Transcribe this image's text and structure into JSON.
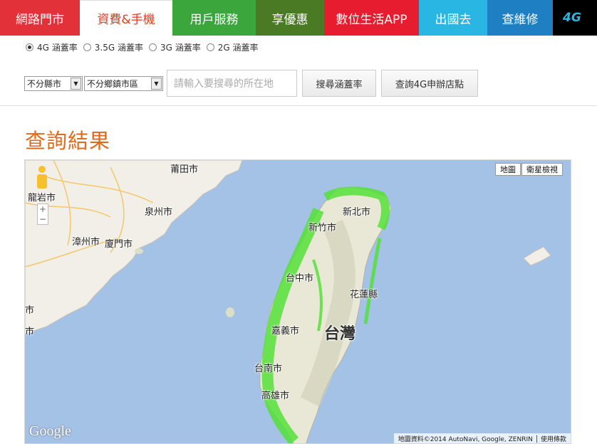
{
  "nav": {
    "items": [
      {
        "label": "網路門市",
        "color": "#e23138"
      },
      {
        "label": "資費&手機",
        "color": "#ffffff",
        "active": true
      },
      {
        "label": "用戶服務",
        "color": "#3aa63c"
      },
      {
        "label": "享優惠",
        "color": "#4b7a24"
      },
      {
        "label": "數位生活APP",
        "color": "#e71c2f"
      },
      {
        "label": "出國去",
        "color": "#2ab6e3"
      },
      {
        "label": "查維修",
        "color": "#1e7fc2"
      },
      {
        "label": "4G",
        "color": "#000000"
      }
    ]
  },
  "coverage": {
    "options": [
      {
        "label": "4G 涵蓋率",
        "selected": true
      },
      {
        "label": "3.5G 涵蓋率",
        "selected": false
      },
      {
        "label": "3G 涵蓋率",
        "selected": false
      },
      {
        "label": "2G 涵蓋率",
        "selected": false
      }
    ]
  },
  "search": {
    "county_select": "不分縣市",
    "district_select": "不分鄉鎮市區",
    "placeholder": "請輸入要搜尋的所在地",
    "search_button": "搜尋涵蓋率",
    "store_button": "查詢4G申辦店點"
  },
  "results": {
    "title": "查詢結果"
  },
  "map": {
    "type_map": "地圖",
    "type_satellite": "衛星檢視",
    "zoom_in": "+",
    "zoom_out": "−",
    "logo": "Google",
    "attribution": "地圖資料©2014 AutoNavi, Google, ZENRIN │ 使用條款",
    "labels": {
      "putian": "莆田市",
      "longyan": "龍岩市",
      "quanzhou": "泉州市",
      "zhangzhou": "漳州市",
      "xiamen": "廈門市",
      "xinbei": "新北市",
      "xinzhu": "新竹市",
      "taizhong": "台中市",
      "hualian": "花蓮縣",
      "jiayi": "嘉義市",
      "taiwan": "台灣",
      "tainan": "台南市",
      "gaoxiong": "高雄市",
      "edge1": "市",
      "edge2": "市"
    },
    "colors": {
      "sea": "#a4c1e6",
      "land": "#f2efe8",
      "island": "#dcdfc8",
      "coverage": "#55e037"
    }
  }
}
